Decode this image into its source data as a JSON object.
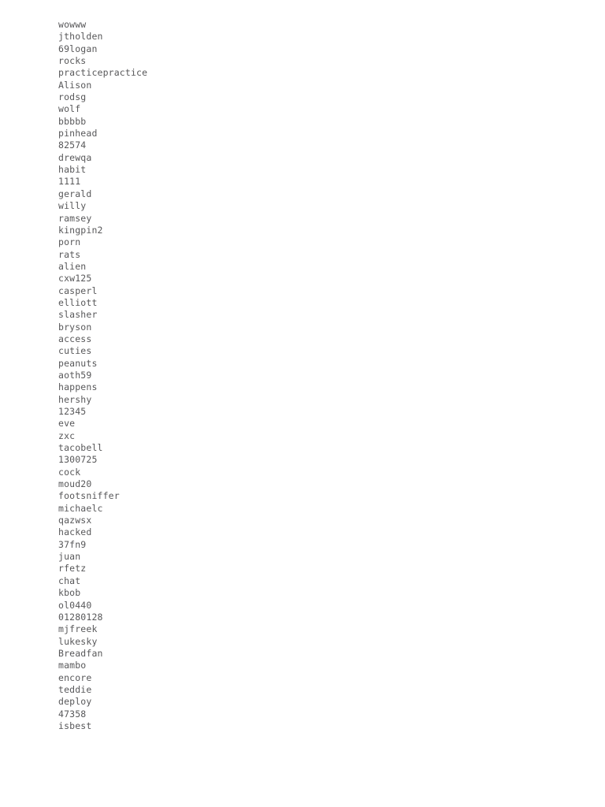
{
  "page": {
    "background_color": "#ffffff",
    "text_color": "#58585a",
    "title": "Word List"
  },
  "word_list": {
    "count": 59,
    "items": [
      "wowww",
      "jtholden",
      "69logan",
      "rocks",
      "practicepractice",
      "Alison",
      "rodsg",
      "wolf",
      "bbbbb",
      "pinhead",
      "82574",
      "drewqa",
      "habit",
      "1111",
      "gerald",
      "willy",
      "ramsey",
      "kingpin2",
      "porn",
      "rats",
      "alien",
      "cxw125",
      "casperl",
      "elliott",
      "slasher",
      "bryson",
      "access",
      "cuties",
      "peanuts",
      "aoth59",
      "happens",
      "hershy",
      "12345",
      "eve",
      "zxc",
      "tacobell",
      "1300725",
      "cock",
      "moud20",
      "footsniffer",
      "michaelc",
      "qazwsx",
      "hacked",
      "37fn9",
      "juan",
      "rfetz",
      "chat",
      "kbob",
      "ol0440",
      "01280128",
      "mjfreek",
      "lukesky",
      "Breadfan",
      "mambo",
      "encore",
      "teddie",
      "deploy",
      "47358",
      "isbest"
    ]
  }
}
